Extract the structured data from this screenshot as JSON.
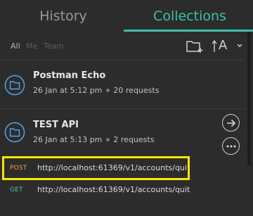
{
  "tabs": [
    {
      "label": "History"
    },
    {
      "label": "Collections"
    }
  ],
  "filters": [
    {
      "label": "All"
    },
    {
      "label": "Me"
    },
    {
      "label": "Team"
    }
  ],
  "toolbar": {
    "new_collection_icon": "new-folder-icon",
    "sort_icon": "sort-alpha-icon",
    "sort_letter": "A"
  },
  "collections": [
    {
      "name": "Postman Echo",
      "date": "26 Jan at 5:12 pm",
      "requests": "20 requests"
    },
    {
      "name": "TEST API",
      "date": "26 Jan at 5:13 pm",
      "requests": "2 requests"
    }
  ],
  "requests": [
    {
      "method": "POST",
      "url": "http://localhost:61369/v1/accounts/quit",
      "color": "#f0a63a"
    },
    {
      "method": "GET",
      "url": "http://localhost:61369/v1/accounts/quit",
      "color": "#43c39c"
    }
  ],
  "colors": {
    "accent": "#3fbfa7",
    "highlight": "#ffe600"
  }
}
